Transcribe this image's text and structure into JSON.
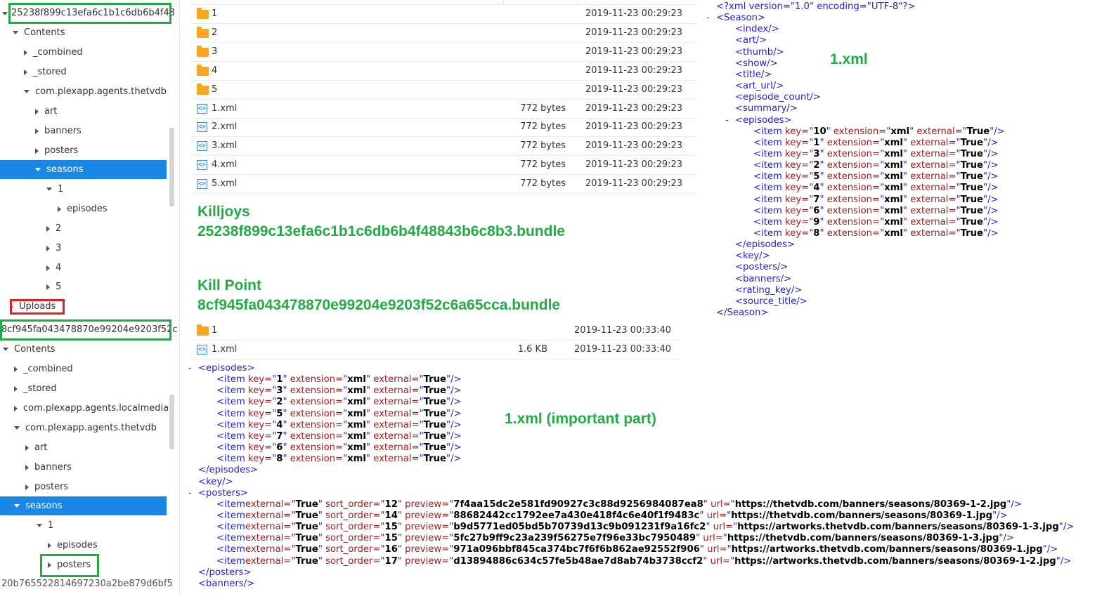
{
  "tree": {
    "bundle1_label": "25238f899c13efa6c1b1c6db6b4f48",
    "bundle1_nodes": [
      {
        "label": "Contents",
        "expanded": true
      },
      {
        "label": "_combined",
        "expanded": false
      },
      {
        "label": "_stored",
        "expanded": false
      },
      {
        "label": "com.plexapp.agents.thetvdb",
        "expanded": true
      },
      {
        "label": "art",
        "expanded": false
      },
      {
        "label": "banners",
        "expanded": false
      },
      {
        "label": "posters",
        "expanded": false
      },
      {
        "label": "seasons",
        "expanded": true,
        "selected": true
      },
      {
        "label": "1",
        "expanded": true
      },
      {
        "label": "episodes",
        "expanded": false
      },
      {
        "label": "2",
        "expanded": false
      },
      {
        "label": "3",
        "expanded": false
      },
      {
        "label": "4",
        "expanded": false
      },
      {
        "label": "5",
        "expanded": false
      }
    ],
    "uploads_label": "Uploads",
    "bundle2_label": "8cf945fa043478870e99204e9203f52c",
    "bundle2_nodes": [
      {
        "label": "Contents",
        "expanded": true
      },
      {
        "label": "_combined",
        "expanded": false
      },
      {
        "label": "_stored",
        "expanded": false
      },
      {
        "label": "com.plexapp.agents.localmedia",
        "expanded": false
      },
      {
        "label": "com.plexapp.agents.thetvdb",
        "expanded": true
      },
      {
        "label": "art",
        "expanded": false
      },
      {
        "label": "banners",
        "expanded": false
      },
      {
        "label": "posters",
        "expanded": false
      },
      {
        "label": "seasons",
        "expanded": true,
        "selected": true
      },
      {
        "label": "1",
        "expanded": true
      },
      {
        "label": "episodes",
        "expanded": false
      },
      {
        "label": "posters",
        "expanded": false
      }
    ],
    "bottom_cut_label": "20b765522814697230a2be879d6bf5"
  },
  "files1": [
    {
      "type": "folder",
      "name": "1",
      "size": "",
      "date": "2019-11-23 00:29:23"
    },
    {
      "type": "folder",
      "name": "2",
      "size": "",
      "date": "2019-11-23 00:29:23"
    },
    {
      "type": "folder",
      "name": "3",
      "size": "",
      "date": "2019-11-23 00:29:23"
    },
    {
      "type": "folder",
      "name": "4",
      "size": "",
      "date": "2019-11-23 00:29:23"
    },
    {
      "type": "folder",
      "name": "5",
      "size": "",
      "date": "2019-11-23 00:29:23"
    },
    {
      "type": "xml",
      "name": "1.xml",
      "size": "772 bytes",
      "date": "2019-11-23 00:29:23"
    },
    {
      "type": "xml",
      "name": "2.xml",
      "size": "772 bytes",
      "date": "2019-11-23 00:29:23"
    },
    {
      "type": "xml",
      "name": "3.xml",
      "size": "772 bytes",
      "date": "2019-11-23 00:29:23"
    },
    {
      "type": "xml",
      "name": "4.xml",
      "size": "772 bytes",
      "date": "2019-11-23 00:29:23"
    },
    {
      "type": "xml",
      "name": "5.xml",
      "size": "772 bytes",
      "date": "2019-11-23 00:29:23"
    }
  ],
  "files2": [
    {
      "type": "folder",
      "name": "1",
      "size": "",
      "date": "2019-11-23 00:33:40"
    },
    {
      "type": "xml",
      "name": "1.xml",
      "size": "1.6 KB",
      "date": "2019-11-23 00:33:40"
    }
  ],
  "annotations": {
    "killjoys_title": "Killjoys",
    "killjoys_bundle": "25238f899c13efa6c1b1c6db6b4f48843b6c8b3.bundle",
    "killpoint_title": "Kill Point",
    "killpoint_bundle": "8cf945fa043478870e99204e9203f52c6a65cca.bundle",
    "xml_label": "1.xml",
    "xml_important_label": "1.xml (important part)"
  },
  "xml1": {
    "decl": "<?xml version=\"1.0\" encoding=\"UTF-8\"?>",
    "season_open": "<Season>",
    "empty_before": [
      "<index/>",
      "<art/>",
      "<thumb/>",
      "<show/>",
      "<title/>",
      "<art_url/>",
      "<episode_count/>",
      "<summary/>"
    ],
    "episodes_open": "<episodes>",
    "items": [
      {
        "key": "10"
      },
      {
        "key": "1"
      },
      {
        "key": "3"
      },
      {
        "key": "2"
      },
      {
        "key": "5"
      },
      {
        "key": "4"
      },
      {
        "key": "7"
      },
      {
        "key": "6"
      },
      {
        "key": "9"
      },
      {
        "key": "8"
      }
    ],
    "episodes_close": "</episodes>",
    "empty_after": [
      "<key/>",
      "<posters/>",
      "<banners/>",
      "<rating_key/>",
      "<source_title/>"
    ],
    "season_close": "</Season>"
  },
  "xml2": {
    "episodes_open": "<episodes>",
    "items": [
      {
        "key": "1"
      },
      {
        "key": "3"
      },
      {
        "key": "2"
      },
      {
        "key": "5"
      },
      {
        "key": "4"
      },
      {
        "key": "7"
      },
      {
        "key": "6"
      },
      {
        "key": "8"
      }
    ],
    "episodes_close": "</episodes>",
    "key_empty": "<key/>",
    "posters_open": "<posters>",
    "posters": [
      {
        "sort_order": "12",
        "preview": "7f4aa15dc2e581fd90927c3c88d9256984087ea8",
        "url": "https://thetvdb.com/banners/seasons/80369-1-2.jpg"
      },
      {
        "sort_order": "14",
        "preview": "88682442cc1792ee7a430e418f4c6e40f1f9483c",
        "url": "https://thetvdb.com/banners/seasons/80369-1.jpg"
      },
      {
        "sort_order": "15",
        "preview": "b9d5771ed05bd5b70739d13c9b091231f9a16fc2",
        "url": "https://artworks.thetvdb.com/banners/seasons/80369-1-3.jpg"
      },
      {
        "sort_order": "15",
        "preview": "5fc27b9ff9c23a239f56275e7f96e33bc7950489",
        "url": "https://thetvdb.com/banners/seasons/80369-1-3.jpg"
      },
      {
        "sort_order": "16",
        "preview": "971a096bbf845ca374bc7f6f6b862ae92552f906",
        "url": "https://artworks.thetvdb.com/banners/seasons/80369-1.jpg"
      },
      {
        "sort_order": "17",
        "preview": "d13894886c634c57fe5b48ae7d8ab74b3738ccf2",
        "url": "https://artworks.thetvdb.com/banners/seasons/80369-1-2.jpg"
      }
    ],
    "posters_close": "</posters>",
    "banners_empty": "<banners/>"
  },
  "xml_strings": {
    "item_open": "<item ",
    "key_attr": "key=",
    "ext_attr": " extension=",
    "ext_val": "xml",
    "external_attr": " external=",
    "external_val": "True",
    "sort_attr": " sort_order=",
    "preview_attr": " preview=",
    "url_attr": " url=",
    "item_close": "/>",
    "quote": "\"",
    "minus": "-"
  }
}
